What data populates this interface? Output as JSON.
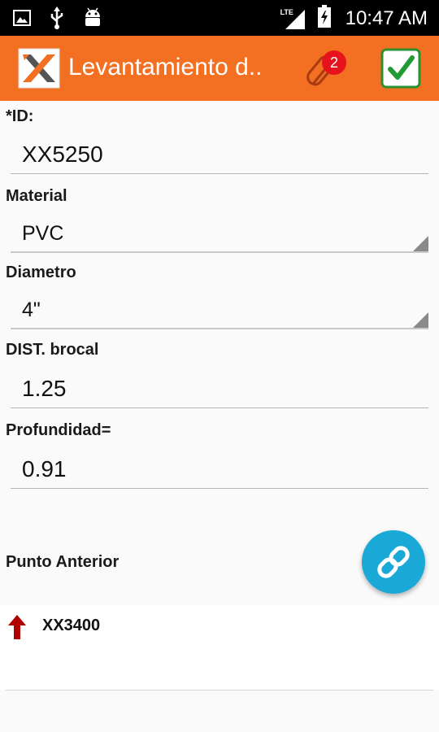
{
  "status_bar": {
    "time": "10:47 AM",
    "network_label": "LTE",
    "icons": [
      "image-icon",
      "usb-icon",
      "android-icon",
      "signal-icon",
      "battery-charging-icon"
    ]
  },
  "app_bar": {
    "title": "Levantamiento d..",
    "attachment_count": "2",
    "logo_icon": "app-logo-icon",
    "attach_icon": "paperclip-icon",
    "confirm_icon": "checkmark-icon"
  },
  "colors": {
    "app_bar": "#f36f21",
    "badge": "#e6131c",
    "fab": "#1aa8d6",
    "confirm_check": "#1f9a34",
    "arrow": "#b00000"
  },
  "form": {
    "id": {
      "label": "*ID:",
      "value": "XX5250"
    },
    "material": {
      "label": "Material",
      "value": "PVC"
    },
    "diametro": {
      "label": "Diametro",
      "value": "4\""
    },
    "dist_brocal": {
      "label": "DIST. brocal",
      "value": "1.25"
    },
    "profundidad": {
      "label": "Profundidad=",
      "value": "0.91"
    }
  },
  "punto_anterior": {
    "label": "Punto Anterior",
    "value": "XX3400",
    "link_icon": "link-icon",
    "arrow_icon": "arrow-up-icon"
  }
}
